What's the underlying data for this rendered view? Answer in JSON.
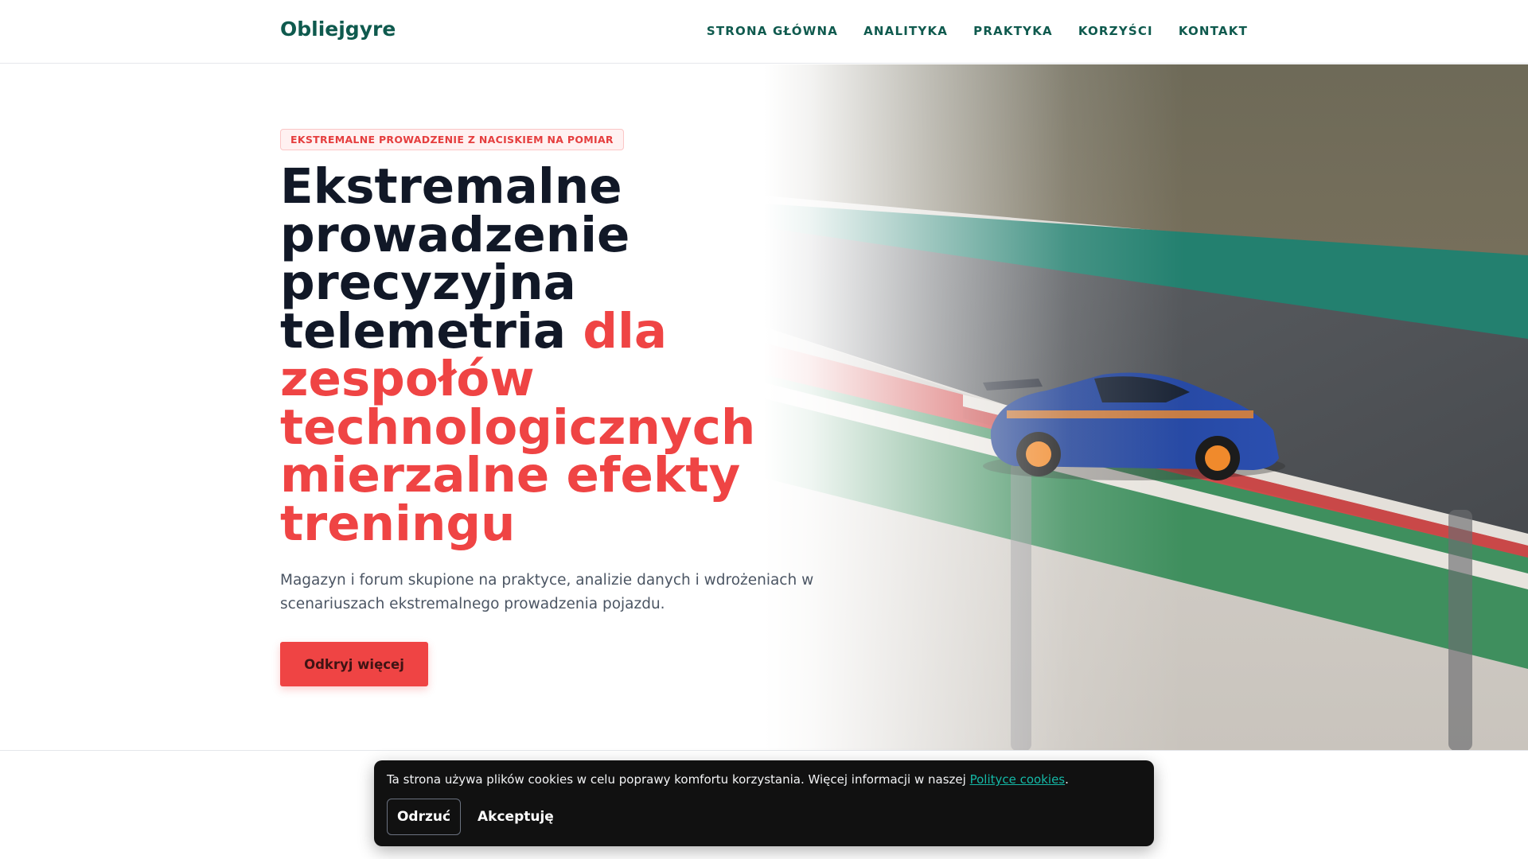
{
  "header": {
    "logo": "Obliejgyre",
    "nav": [
      "STRONA GŁÓWNA",
      "ANALITYKA",
      "PRAKTYKA",
      "KORZYŚCI",
      "KONTAKT"
    ]
  },
  "hero": {
    "badge": "EKSTREMALNE PROWADZENIE Z NACISKIEM NA POMIAR",
    "headline_dark": "Ekstremalne prowadzenie precyzyjna telemetria",
    "headline_accent": "dla zespołów technologicznych mierzalne efekty treningu",
    "lead": "Magazyn i forum skupione na praktyce, analizie danych i wdrożeniach w scenariuszach ekstremalnego prowadzenia pojazdu.",
    "cta_label": "Odkryj więcej",
    "image_alt": "race-car-on-track-photo"
  },
  "cookie_banner": {
    "text_before_link": "Ta strona używa plików cookies w celu poprawy komfortu korzystania. Więcej informacji w naszej ",
    "link_text": "Polityce cookies",
    "text_after_link": ".",
    "reject_label": "Odrzuć",
    "accept_label": "Akceptuję"
  },
  "colors": {
    "brand": "#0f5a4e",
    "accent": "#ef4444",
    "heading": "#111827",
    "cookie_bg": "#111111",
    "cookie_link": "#14b8a6"
  }
}
